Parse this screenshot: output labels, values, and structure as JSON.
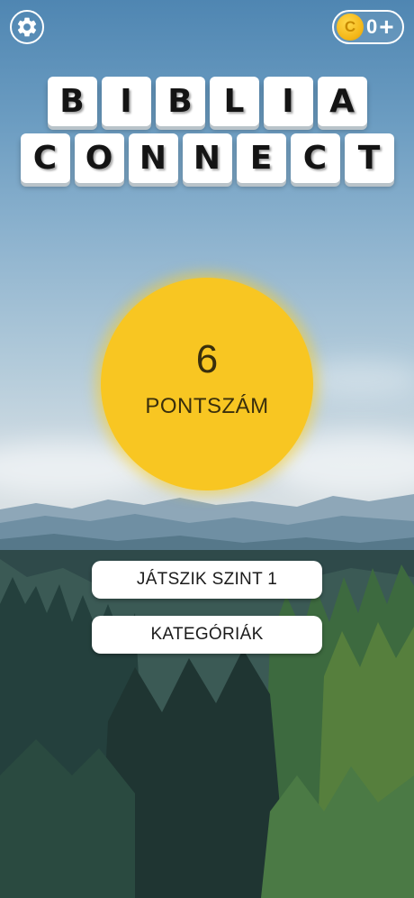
{
  "header": {
    "settings_icon": "gear-icon",
    "coins": {
      "icon": "coin-icon",
      "symbol": "C",
      "count": "0",
      "plus": "+"
    }
  },
  "title": {
    "line1": [
      "B",
      "I",
      "B",
      "L",
      "I",
      "A"
    ],
    "line2": [
      "C",
      "O",
      "N",
      "N",
      "E",
      "C",
      "T"
    ]
  },
  "score": {
    "value": "6",
    "label": "PONTSZÁM"
  },
  "buttons": {
    "play": "JÁTSZIK SZINT 1",
    "categories": "KATEGÓRIÁK"
  },
  "colors": {
    "score_circle": "#f8c622",
    "tile": "#ffffff",
    "button": "#ffffff"
  }
}
